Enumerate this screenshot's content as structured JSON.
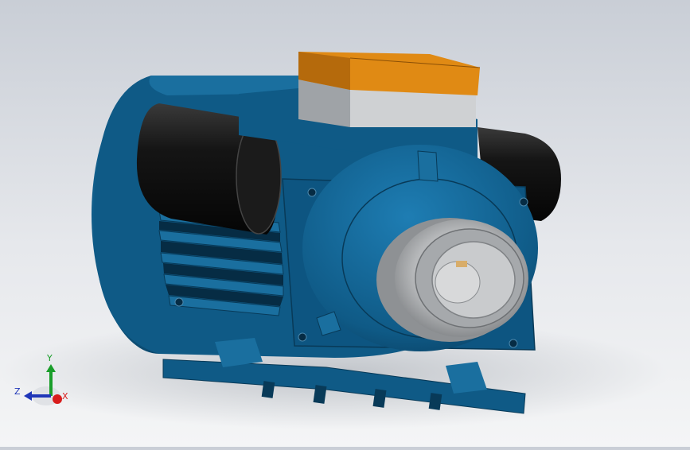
{
  "viewport": {
    "background_top": "#c9ced6",
    "background_bottom": "#f4f5f6",
    "model_body_color": "#0f5a86",
    "model_body_dark": "#0a3f60",
    "capacitor_color": "#111111",
    "terminal_box_lid": "#e08a14",
    "terminal_box_base": "#c8c8c8",
    "pulley_color": "#b5b7b9"
  },
  "triad": {
    "y_label": "Y",
    "z_label": "Z",
    "x_label": "X",
    "y_color": "#1a9e2a",
    "z_color": "#1f36b8",
    "x_color": "#d81c1c"
  }
}
